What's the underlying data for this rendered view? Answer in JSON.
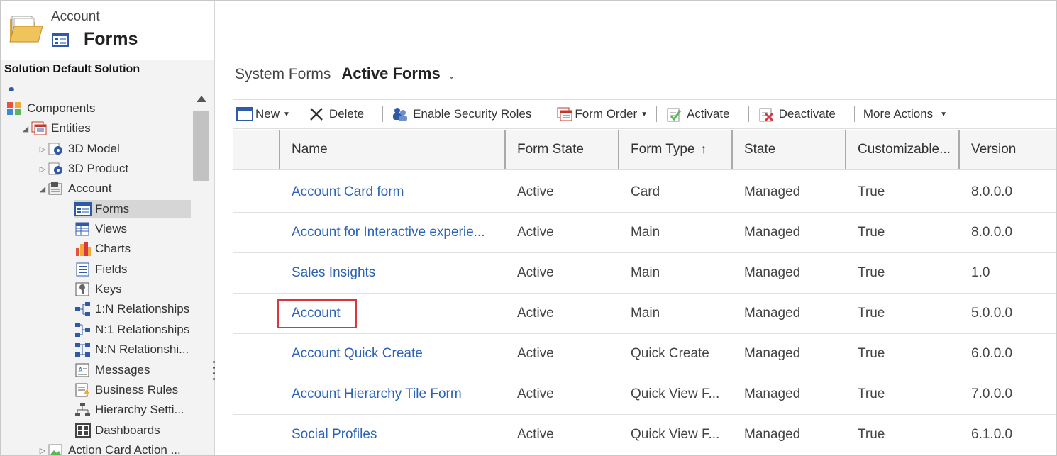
{
  "header": {
    "entity": "Account",
    "title": "Forms"
  },
  "solution_label": "Solution Default Solution",
  "tree": {
    "components": "Components",
    "entities": "Entities",
    "model3d": "3D Model",
    "product3d": "3D Product",
    "account": "Account",
    "children": [
      "Forms",
      "Views",
      "Charts",
      "Fields",
      "Keys",
      "1:N Relationships",
      "N:1 Relationships",
      "N:N Relationshi...",
      "Messages",
      "Business Rules",
      "Hierarchy Setti...",
      "Dashboards"
    ],
    "next_entity": "Action Card Action ..."
  },
  "view": {
    "prefix": "System Forms",
    "name": "Active Forms"
  },
  "toolbar": {
    "new": "New",
    "delete": "Delete",
    "enable_security_roles": "Enable Security Roles",
    "form_order": "Form Order",
    "activate": "Activate",
    "deactivate": "Deactivate",
    "more_actions": "More Actions"
  },
  "columns": [
    "Name",
    "Form State",
    "Form Type",
    "State",
    "Customizable...",
    "Version"
  ],
  "rows": [
    {
      "name": "Account Card form",
      "form_state": "Active",
      "form_type": "Card",
      "state": "Managed",
      "customizable": "True",
      "version": "8.0.0.0"
    },
    {
      "name": "Account for Interactive experie...",
      "form_state": "Active",
      "form_type": "Main",
      "state": "Managed",
      "customizable": "True",
      "version": "8.0.0.0"
    },
    {
      "name": "Sales Insights",
      "form_state": "Active",
      "form_type": "Main",
      "state": "Managed",
      "customizable": "True",
      "version": "1.0"
    },
    {
      "name": "Account",
      "form_state": "Active",
      "form_type": "Main",
      "state": "Managed",
      "customizable": "True",
      "version": "5.0.0.0"
    },
    {
      "name": "Account Quick Create",
      "form_state": "Active",
      "form_type": "Quick Create",
      "state": "Managed",
      "customizable": "True",
      "version": "6.0.0.0"
    },
    {
      "name": "Account Hierarchy Tile Form",
      "form_state": "Active",
      "form_type": "Quick View F...",
      "state": "Managed",
      "customizable": "True",
      "version": "7.0.0.0"
    },
    {
      "name": "Social Profiles",
      "form_state": "Active",
      "form_type": "Quick View F...",
      "state": "Managed",
      "customizable": "True",
      "version": "6.1.0.0"
    }
  ],
  "colors": {
    "link": "#2b63b6",
    "highlight_border": "#d9363e",
    "selected_node": "#d6d6d6"
  }
}
